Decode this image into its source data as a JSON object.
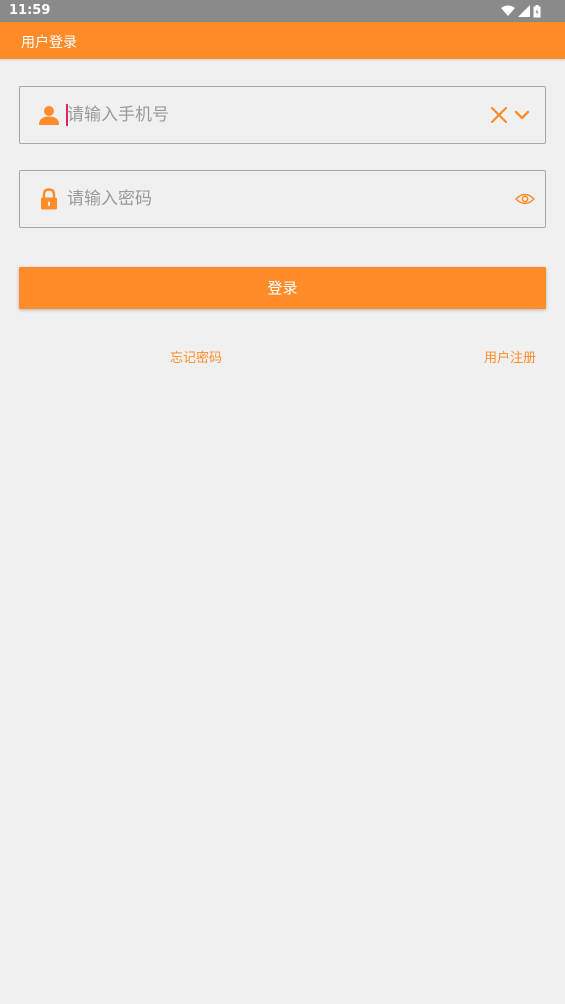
{
  "status_bar": {
    "time": "11:59",
    "icons": [
      "wifi-icon",
      "signal-icon",
      "battery-icon"
    ]
  },
  "app_bar": {
    "title": "用户登录"
  },
  "phone_field": {
    "placeholder": "请输入手机号",
    "value": "",
    "icons": [
      "user-icon",
      "clear-icon",
      "chevron-down-icon"
    ]
  },
  "password_field": {
    "placeholder": "请输入密码",
    "value": "",
    "icons": [
      "lock-icon",
      "eye-icon"
    ]
  },
  "login_button": {
    "label": "登录"
  },
  "links": {
    "forgot_password": "忘记密码",
    "register": "用户注册"
  },
  "colors": {
    "accent": "#ff8c29",
    "background": "#f0f0f0",
    "status_bar": "#8a8a8a",
    "placeholder": "#9a9a9a",
    "cursor": "#e0206a"
  }
}
